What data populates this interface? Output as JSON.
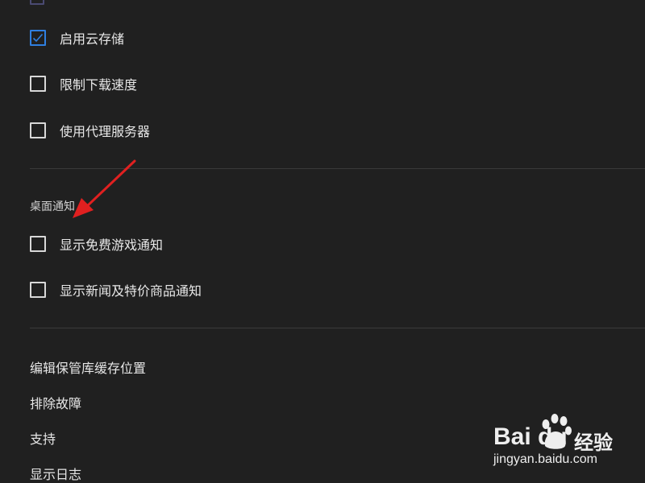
{
  "settings": {
    "checkboxes": [
      {
        "label": "启用云存储",
        "checked": true
      },
      {
        "label": "限制下载速度",
        "checked": false
      },
      {
        "label": "使用代理服务器",
        "checked": false
      }
    ]
  },
  "notifications": {
    "heading": "桌面通知",
    "checkboxes": [
      {
        "label": "显示免费游戏通知",
        "checked": false
      },
      {
        "label": "显示新闻及特价商品通知",
        "checked": false
      }
    ]
  },
  "links": [
    "编辑保管库缓存位置",
    "排除故障",
    "支持",
    "显示日志"
  ],
  "colors": {
    "background": "#202020",
    "checked_accent": "#2f7fe0",
    "annotation_arrow": "#e02020"
  },
  "watermark": {
    "brand": "Bai du",
    "suffix": "经验",
    "url": "jingyan.baidu.com"
  }
}
